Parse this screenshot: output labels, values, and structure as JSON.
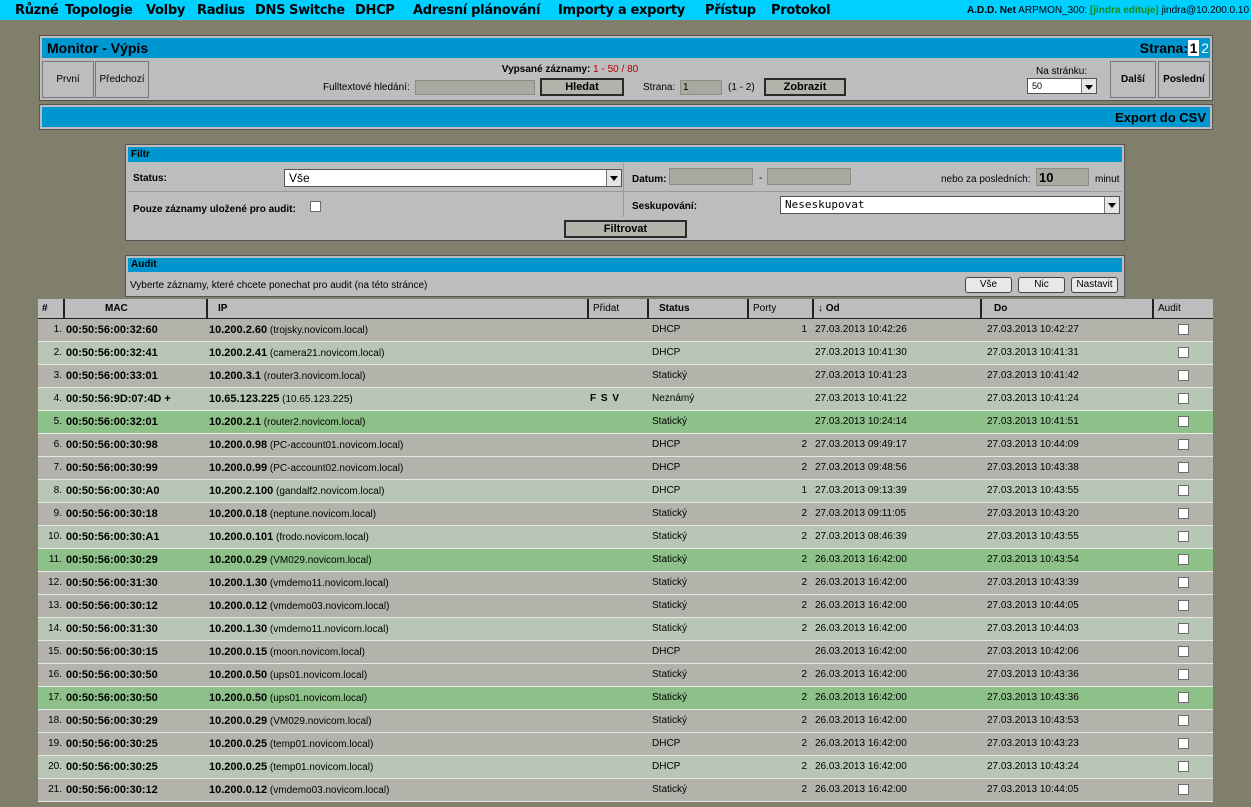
{
  "menu": [
    "Různé",
    "Topologie",
    "Volby",
    "Radius",
    "DNS",
    "Switche",
    "DHCP",
    "Adresní plánování",
    "Importy a exporty",
    "Přístup",
    "Protokol"
  ],
  "session": {
    "app": "A.D.D. Net",
    "module": "ARPMON_300:",
    "edit": "[jindra edituje]",
    "user": "jindra@10.200.0.10"
  },
  "monitor": {
    "title": "Monitor - Výpis",
    "page_label": "Strana:",
    "pages": [
      "1",
      "2"
    ],
    "first": "První",
    "prev": "Předchozí",
    "records_label": "Vypsané záznamy:",
    "records_from": "1",
    "records_sep": "-",
    "records_to": "50",
    "records_slash": "/",
    "records_total": "80",
    "fulltext_label": "Fulltextové hledání:",
    "fulltext_value": "",
    "search_button": "Hledat",
    "page_input_label": "Strana:",
    "page_input_value": "1",
    "page_range": "(1 - 2)",
    "show_button": "Zobrazit",
    "per_page_label": "Na stránku:",
    "per_page_value": "50",
    "next": "Další",
    "last": "Poslední",
    "export": "Export do CSV"
  },
  "filter": {
    "title": "Filtr",
    "status_label": "Status:",
    "status_value": "Vše",
    "date_label": "Datum:",
    "date_from": "",
    "date_dash": "-",
    "date_to": "",
    "last_label": "nebo za posledních:",
    "last_value": "10",
    "last_unit": "minut",
    "audit_only_label": "Pouze záznamy uložené pro audit:",
    "group_label": "Seskupování:",
    "group_value": "Neseskupovat",
    "filter_button": "Filtrovat"
  },
  "audit": {
    "title": "Audit",
    "hint": "Vyberte záznamy, které chcete ponechat pro audit (na této stránce)",
    "all": "Vše",
    "none": "Nic",
    "set": "Nastavit"
  },
  "table": {
    "headers": {
      "num": "#",
      "mac": "MAC",
      "ip": "IP",
      "pridat": "Přidat",
      "status": "Status",
      "porty": "Porty",
      "od": "↓ Od",
      "do": "Do",
      "audit": "Audit"
    },
    "rows": [
      {
        "n": "1.",
        "mac": "00:50:56:00:32:60",
        "ip": "10.200.2.60",
        "host": "(trojsky.novicom.local)",
        "pridat": "",
        "status": "DHCP",
        "porty": "1",
        "od": "27.03.2013 10:42:26",
        "do": "27.03.2013 10:42:27",
        "style": "g"
      },
      {
        "n": "2.",
        "mac": "00:50:56:00:32:41",
        "ip": "10.200.2.41",
        "host": "(camera21.novicom.local)",
        "pridat": "",
        "status": "DHCP",
        "porty": "",
        "od": "27.03.2013 10:41:30",
        "do": "27.03.2013 10:41:31",
        "style": "l"
      },
      {
        "n": "3.",
        "mac": "00:50:56:00:33:01",
        "ip": "10.200.3.1",
        "host": "(router3.novicom.local)",
        "pridat": "",
        "status": "Statický",
        "porty": "",
        "od": "27.03.2013 10:41:23",
        "do": "27.03.2013 10:41:42",
        "style": "g"
      },
      {
        "n": "4.",
        "mac": "00:50:56:9D:07:4D +",
        "ip": "10.65.123.225",
        "host": "(10.65.123.225)",
        "pridat": "F S V",
        "status": "Neznámý",
        "porty": "",
        "od": "27.03.2013 10:41:22",
        "do": "27.03.2013 10:41:24",
        "style": "l"
      },
      {
        "n": "5.",
        "mac": "00:50:56:00:32:01",
        "ip": "10.200.2.1",
        "host": "(router2.novicom.local)",
        "pridat": "",
        "status": "Statický",
        "porty": "",
        "od": "27.03.2013 10:24:14",
        "do": "27.03.2013 10:41:51",
        "style": "h"
      },
      {
        "n": "6.",
        "mac": "00:50:56:00:30:98",
        "ip": "10.200.0.98",
        "host": "(PC-account01.novicom.local)",
        "pridat": "",
        "status": "DHCP",
        "porty": "2",
        "od": "27.03.2013 09:49:17",
        "do": "27.03.2013 10:44:09",
        "style": "g"
      },
      {
        "n": "7.",
        "mac": "00:50:56:00:30:99",
        "ip": "10.200.0.99",
        "host": "(PC-account02.novicom.local)",
        "pridat": "",
        "status": "DHCP",
        "porty": "2",
        "od": "27.03.2013 09:48:56",
        "do": "27.03.2013 10:43:38",
        "style": "g"
      },
      {
        "n": "8.",
        "mac": "00:50:56:00:30:A0",
        "ip": "10.200.2.100",
        "host": "(gandalf2.novicom.local)",
        "pridat": "",
        "status": "DHCP",
        "porty": "1",
        "od": "27.03.2013 09:13:39",
        "do": "27.03.2013 10:43:55",
        "style": "l"
      },
      {
        "n": "9.",
        "mac": "00:50:56:00:30:18",
        "ip": "10.200.0.18",
        "host": "(neptune.novicom.local)",
        "pridat": "",
        "status": "Statický",
        "porty": "2",
        "od": "27.03.2013 09:11:05",
        "do": "27.03.2013 10:43:20",
        "style": "g"
      },
      {
        "n": "10.",
        "mac": "00:50:56:00:30:A1",
        "ip": "10.200.0.101",
        "host": "(frodo.novicom.local)",
        "pridat": "",
        "status": "Statický",
        "porty": "2",
        "od": "27.03.2013 08:46:39",
        "do": "27.03.2013 10:43:55",
        "style": "l"
      },
      {
        "n": "11.",
        "mac": "00:50:56:00:30:29",
        "ip": "10.200.0.29",
        "host": "(VM029.novicom.local)",
        "pridat": "",
        "status": "Statický",
        "porty": "2",
        "od": "26.03.2013 16:42:00",
        "do": "27.03.2013 10:43:54",
        "style": "h"
      },
      {
        "n": "12.",
        "mac": "00:50:56:00:31:30",
        "ip": "10.200.1.30",
        "host": "(vmdemo11.novicom.local)",
        "pridat": "",
        "status": "Statický",
        "porty": "2",
        "od": "26.03.2013 16:42:00",
        "do": "27.03.2013 10:43:39",
        "style": "g"
      },
      {
        "n": "13.",
        "mac": "00:50:56:00:30:12",
        "ip": "10.200.0.12",
        "host": "(vmdemo03.novicom.local)",
        "pridat": "",
        "status": "Statický",
        "porty": "2",
        "od": "26.03.2013 16:42:00",
        "do": "27.03.2013 10:44:05",
        "style": "g"
      },
      {
        "n": "14.",
        "mac": "00:50:56:00:31:30",
        "ip": "10.200.1.30",
        "host": "(vmdemo11.novicom.local)",
        "pridat": "",
        "status": "Statický",
        "porty": "2",
        "od": "26.03.2013 16:42:00",
        "do": "27.03.2013 10:44:03",
        "style": "l"
      },
      {
        "n": "15.",
        "mac": "00:50:56:00:30:15",
        "ip": "10.200.0.15",
        "host": "(moon.novicom.local)",
        "pridat": "",
        "status": "DHCP",
        "porty": "",
        "od": "26.03.2013 16:42:00",
        "do": "27.03.2013 10:42:06",
        "style": "g"
      },
      {
        "n": "16.",
        "mac": "00:50:56:00:30:50",
        "ip": "10.200.0.50",
        "host": "(ups01.novicom.local)",
        "pridat": "",
        "status": "Statický",
        "porty": "2",
        "od": "26.03.2013 16:42:00",
        "do": "27.03.2013 10:43:36",
        "style": "g"
      },
      {
        "n": "17.",
        "mac": "00:50:56:00:30:50",
        "ip": "10.200.0.50",
        "host": "(ups01.novicom.local)",
        "pridat": "",
        "status": "Statický",
        "porty": "2",
        "od": "26.03.2013 16:42:00",
        "do": "27.03.2013 10:43:36",
        "style": "h"
      },
      {
        "n": "18.",
        "mac": "00:50:56:00:30:29",
        "ip": "10.200.0.29",
        "host": "(VM029.novicom.local)",
        "pridat": "",
        "status": "Statický",
        "porty": "2",
        "od": "26.03.2013 16:42:00",
        "do": "27.03.2013 10:43:53",
        "style": "g"
      },
      {
        "n": "19.",
        "mac": "00:50:56:00:30:25",
        "ip": "10.200.0.25",
        "host": "(temp01.novicom.local)",
        "pridat": "",
        "status": "DHCP",
        "porty": "2",
        "od": "26.03.2013 16:42:00",
        "do": "27.03.2013 10:43:23",
        "style": "g"
      },
      {
        "n": "20.",
        "mac": "00:50:56:00:30:25",
        "ip": "10.200.0.25",
        "host": "(temp01.novicom.local)",
        "pridat": "",
        "status": "DHCP",
        "porty": "2",
        "od": "26.03.2013 16:42:00",
        "do": "27.03.2013 10:43:24",
        "style": "l"
      },
      {
        "n": "21.",
        "mac": "00:50:56:00:30:12",
        "ip": "10.200.0.12",
        "host": "(vmdemo03.novicom.local)",
        "pridat": "",
        "status": "Statický",
        "porty": "2",
        "od": "26.03.2013 16:42:00",
        "do": "27.03.2013 10:44:05",
        "style": "g"
      }
    ]
  }
}
